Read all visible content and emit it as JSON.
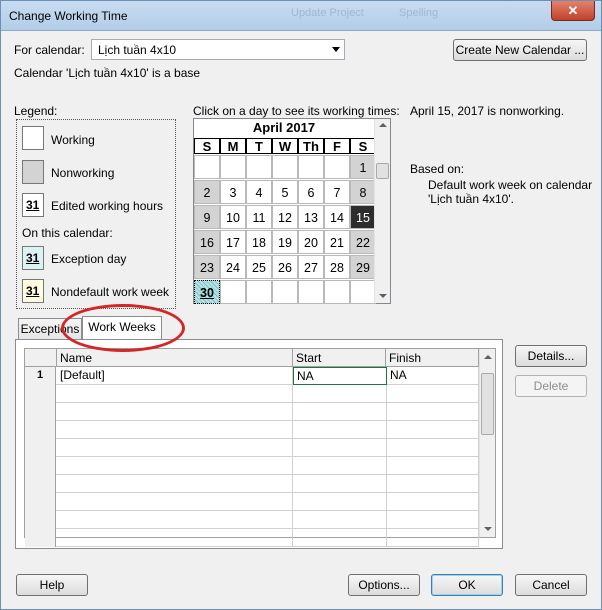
{
  "window": {
    "title": "Change Working Time",
    "close_symbol": "✕",
    "ghost_labels": [
      "Update Project",
      "Spelling"
    ]
  },
  "calendar_picker": {
    "label": "For calendar:",
    "value": "Lịch tuần 4x10",
    "base_note": "Calendar 'Lịch tuần 4x10' is a base"
  },
  "create_calendar_label": "Create New Calendar ...",
  "legend": {
    "title": "Legend:",
    "working": "Working",
    "nonworking": "Nonworking",
    "edited": "Edited working hours",
    "edited_num": "31",
    "on_this_calendar": "On this calendar:",
    "exception": "Exception day",
    "exception_num": "31",
    "nondefault": "Nondefault work week",
    "nondefault_num": "31"
  },
  "calendar": {
    "instruction": "Click on a day to see its working times:",
    "month_label": "April 2017",
    "days_of_week": [
      "S",
      "M",
      "T",
      "W",
      "Th",
      "F",
      "S"
    ],
    "weeks": [
      [
        "",
        "",
        "",
        "",
        "",
        "",
        "1"
      ],
      [
        "2",
        "3",
        "4",
        "5",
        "6",
        "7",
        "8"
      ],
      [
        "9",
        "10",
        "11",
        "12",
        "13",
        "14",
        "15"
      ],
      [
        "16",
        "17",
        "18",
        "19",
        "20",
        "21",
        "22"
      ],
      [
        "23",
        "24",
        "25",
        "26",
        "27",
        "28",
        "29"
      ],
      [
        "30",
        "",
        "",
        "",
        "",
        "",
        ""
      ]
    ]
  },
  "info": {
    "status": "April 15, 2017 is nonworking.",
    "based_on_label": "Based on:",
    "based_on_text": "Default work week on calendar 'Lịch tuần 4x10'."
  },
  "tabs": [
    {
      "label": "Exceptions"
    },
    {
      "label": "Work Weeks"
    }
  ],
  "table": {
    "headers": [
      "Name",
      "Start",
      "Finish"
    ],
    "rows": [
      {
        "num": "1",
        "name": "[Default]",
        "start": "NA",
        "finish": "NA"
      }
    ]
  },
  "side_buttons": {
    "details": "Details...",
    "delete": "Delete"
  },
  "footer": {
    "help": "Help",
    "options": "Options...",
    "ok": "OK",
    "cancel": "Cancel"
  },
  "colors": {
    "nonworking": "#d3d3d3",
    "selected_day": "#2d2d2d",
    "annotation": "#d42626"
  }
}
